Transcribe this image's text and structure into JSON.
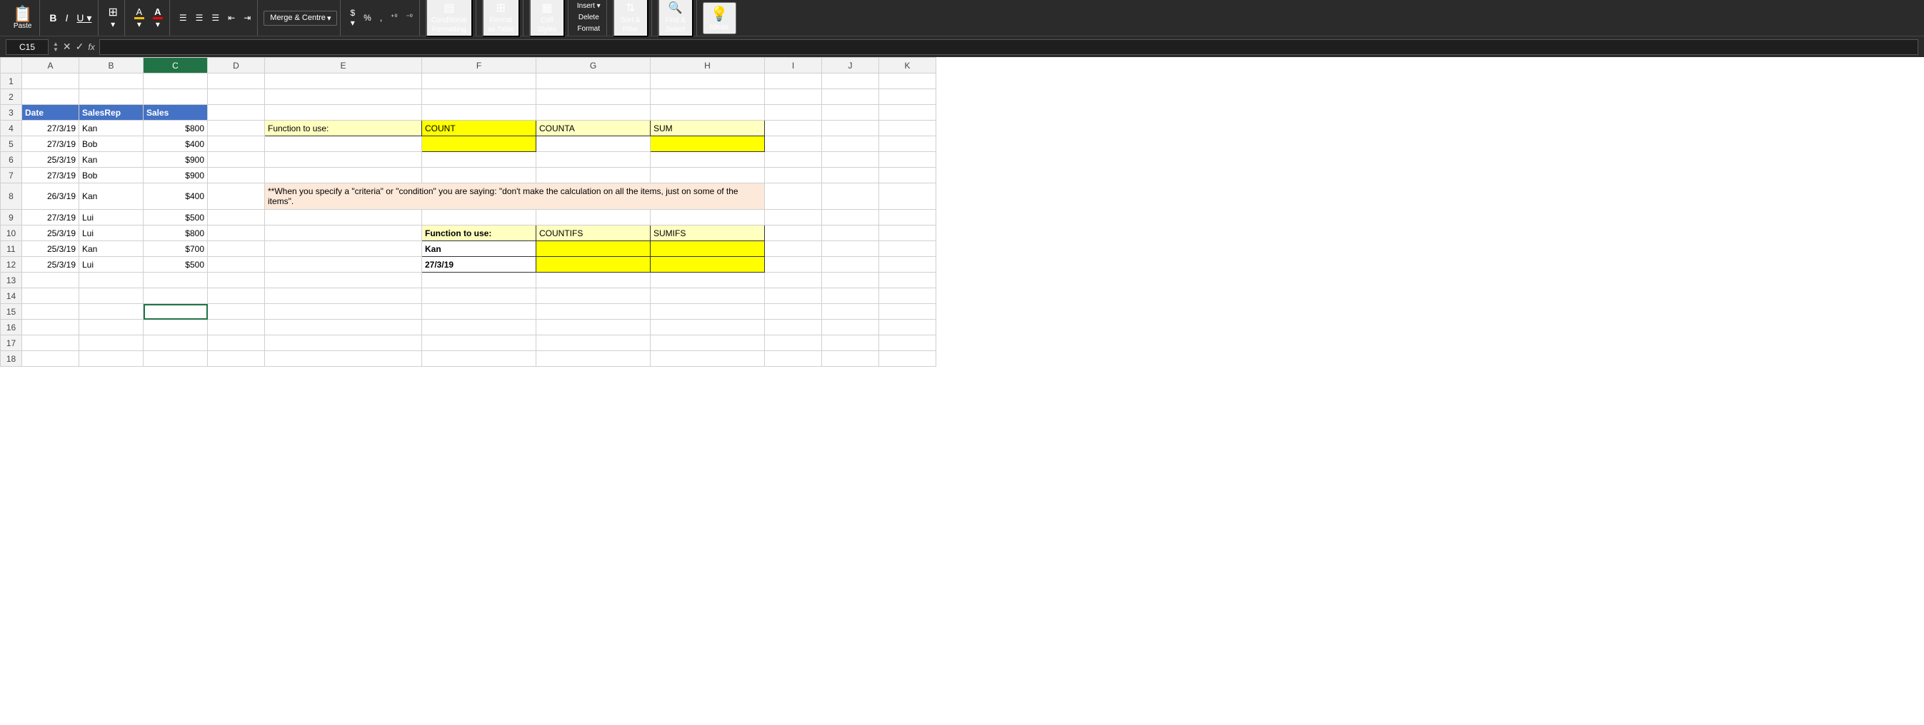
{
  "toolbar": {
    "paste_label": "Paste",
    "bold_label": "B",
    "italic_label": "I",
    "underline_label": "U",
    "merge_label": "Merge & Centre",
    "dollar_label": "$",
    "percent_label": "%",
    "comma_label": ",",
    "increase_decimal": "+0",
    "decrease_decimal": "-0",
    "conditional_formatting": "Conditional\nFormatting",
    "format_as_table": "Format\nas Table",
    "cell_styles": "Cell\nStyles",
    "format": "Format",
    "sort_filter": "Sort &\nFilter",
    "find_select": "Find &\nSelect",
    "ideas": "Ideas",
    "delete_label": "Delete"
  },
  "formula_bar": {
    "cell_ref": "C15",
    "formula": ""
  },
  "columns": [
    "",
    "A",
    "B",
    "C",
    "D",
    "E",
    "F",
    "G",
    "H",
    "I",
    "J",
    "K"
  ],
  "rows": {
    "count": 18
  },
  "data_table": {
    "headers": [
      "Date",
      "SalesRep",
      "Sales"
    ],
    "rows": [
      [
        "27/3/19",
        "Kan",
        "$800"
      ],
      [
        "27/3/19",
        "Bob",
        "$400"
      ],
      [
        "25/3/19",
        "Kan",
        "$900"
      ],
      [
        "27/3/19",
        "Bob",
        "$900"
      ],
      [
        "26/3/19",
        "Kan",
        "$400"
      ],
      [
        "27/3/19",
        "Lui",
        "$500"
      ],
      [
        "25/3/19",
        "Lui",
        "$800"
      ],
      [
        "25/3/19",
        "Kan",
        "$700"
      ],
      [
        "25/3/19",
        "Lui",
        "$500"
      ]
    ]
  },
  "function_table_1": {
    "label": "Function to use:",
    "count": "COUNT",
    "counta": "COUNTA",
    "sum": "SUM"
  },
  "criteria_note": "**When you specify a \"criteria\" or \"condition\" you are saying: \"don't make the\ncalculation on all the items, just on some of the items\".",
  "function_table_2": {
    "label": "Function to use:",
    "countifs": "COUNTIFS",
    "sumifs": "SUMIFS",
    "row1_label": "Kan",
    "row2_label": "27/3/19"
  }
}
